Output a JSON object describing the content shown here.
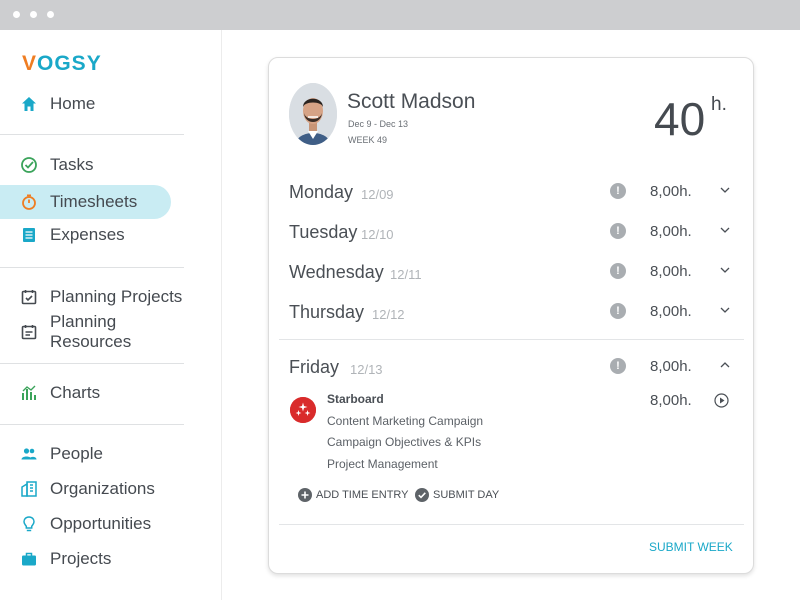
{
  "brand": {
    "logo_v": "V",
    "logo_rest": "OGSY",
    "colors": {
      "orange": "#ef7d22",
      "teal": "#1aa8c8",
      "red": "#d92b2b"
    }
  },
  "nav": {
    "home": {
      "label": "Home",
      "icon": "home-icon"
    },
    "tasks": {
      "label": "Tasks",
      "icon": "check-circle-icon"
    },
    "timesheets": {
      "label": "Timesheets",
      "icon": "stopwatch-icon",
      "active": true
    },
    "expenses": {
      "label": "Expenses",
      "icon": "document-icon"
    },
    "planning_projects": {
      "label": "Planning Projects",
      "icon": "calendar-check-icon"
    },
    "planning_resources": {
      "label": "Planning Resources",
      "icon": "calendar-list-icon"
    },
    "charts": {
      "label": "Charts",
      "icon": "chart-icon"
    },
    "people": {
      "label": "People",
      "icon": "people-icon"
    },
    "organizations": {
      "label": "Organizations",
      "icon": "building-icon"
    },
    "opportunities": {
      "label": "Opportunities",
      "icon": "lightbulb-icon"
    },
    "projects": {
      "label": "Projects",
      "icon": "briefcase-icon"
    }
  },
  "timesheet": {
    "person": {
      "name": "Scott Madson",
      "range": "Dec 9 - Dec 13",
      "week": "WEEK 49"
    },
    "total": {
      "value": "40",
      "unit": "h."
    },
    "days": [
      {
        "name": "Monday",
        "date": "12/09",
        "hours": "8,00h.",
        "expanded": false
      },
      {
        "name": "Tuesday",
        "date": "12/10",
        "hours": "8,00h.",
        "expanded": false
      },
      {
        "name": "Wednesday",
        "date": "12/11",
        "hours": "8,00h.",
        "expanded": false
      },
      {
        "name": "Thursday",
        "date": "12/12",
        "hours": "8,00h.",
        "expanded": false
      },
      {
        "name": "Friday",
        "date": "12/13",
        "hours": "8,00h.",
        "expanded": true
      }
    ],
    "entry": {
      "project": "Starboard",
      "tasks": [
        "Content Marketing Campaign",
        "Campaign Objectives & KPIs",
        "Project Management"
      ],
      "hours": "8,00h."
    },
    "actions": {
      "add_time_entry": "ADD TIME ENTRY",
      "submit_day": "SUBMIT DAY",
      "submit_week": "SUBMIT WEEK"
    }
  }
}
